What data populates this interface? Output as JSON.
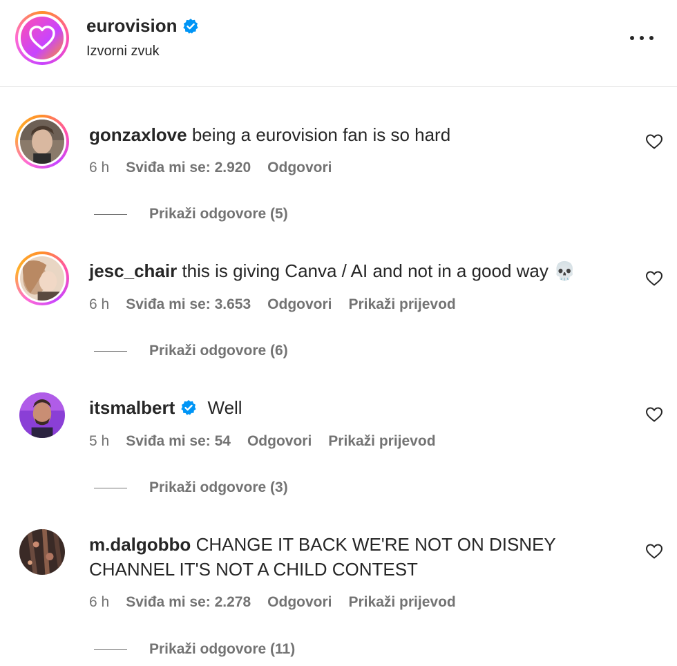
{
  "post": {
    "username": "eurovision",
    "audio": "Izvorni zvuk"
  },
  "comments": [
    {
      "username": "gonzaxlove",
      "text": "being a eurovision fan is so hard",
      "time": "6 h",
      "likes": "Sviđa mi se: 2.920",
      "reply": "Odgovori",
      "translate": "",
      "view_replies": "Prikaži odgovore (5)"
    },
    {
      "username": "jesc_chair",
      "text": "this is giving Canva / AI and not in a good way 💀",
      "time": "6 h",
      "likes": "Sviđa mi se: 3.653",
      "reply": "Odgovori",
      "translate": "Prikaži prijevod",
      "view_replies": "Prikaži odgovore (6)"
    },
    {
      "username": "itsmalbert",
      "text": "Well",
      "time": "5 h",
      "likes": "Sviđa mi se: 54",
      "reply": "Odgovori",
      "translate": "Prikaži prijevod",
      "view_replies": "Prikaži odgovore (3)"
    },
    {
      "username": "m.dalgobbo",
      "text": "CHANGE IT BACK WE'RE NOT ON DISNEY CHANNEL IT'S NOT A CHILD CONTEST",
      "time": "6 h",
      "likes": "Sviđa mi se: 2.278",
      "reply": "Odgovori",
      "translate": "Prikaži prijevod",
      "view_replies": "Prikaži odgovore (11)"
    }
  ],
  "icons": {
    "verified": "verified-badge-icon",
    "like": "heart-outline-icon",
    "more": "more-options-icon"
  },
  "colors": {
    "verified": "#0095f6",
    "text": "#262626",
    "secondary": "#737373"
  }
}
